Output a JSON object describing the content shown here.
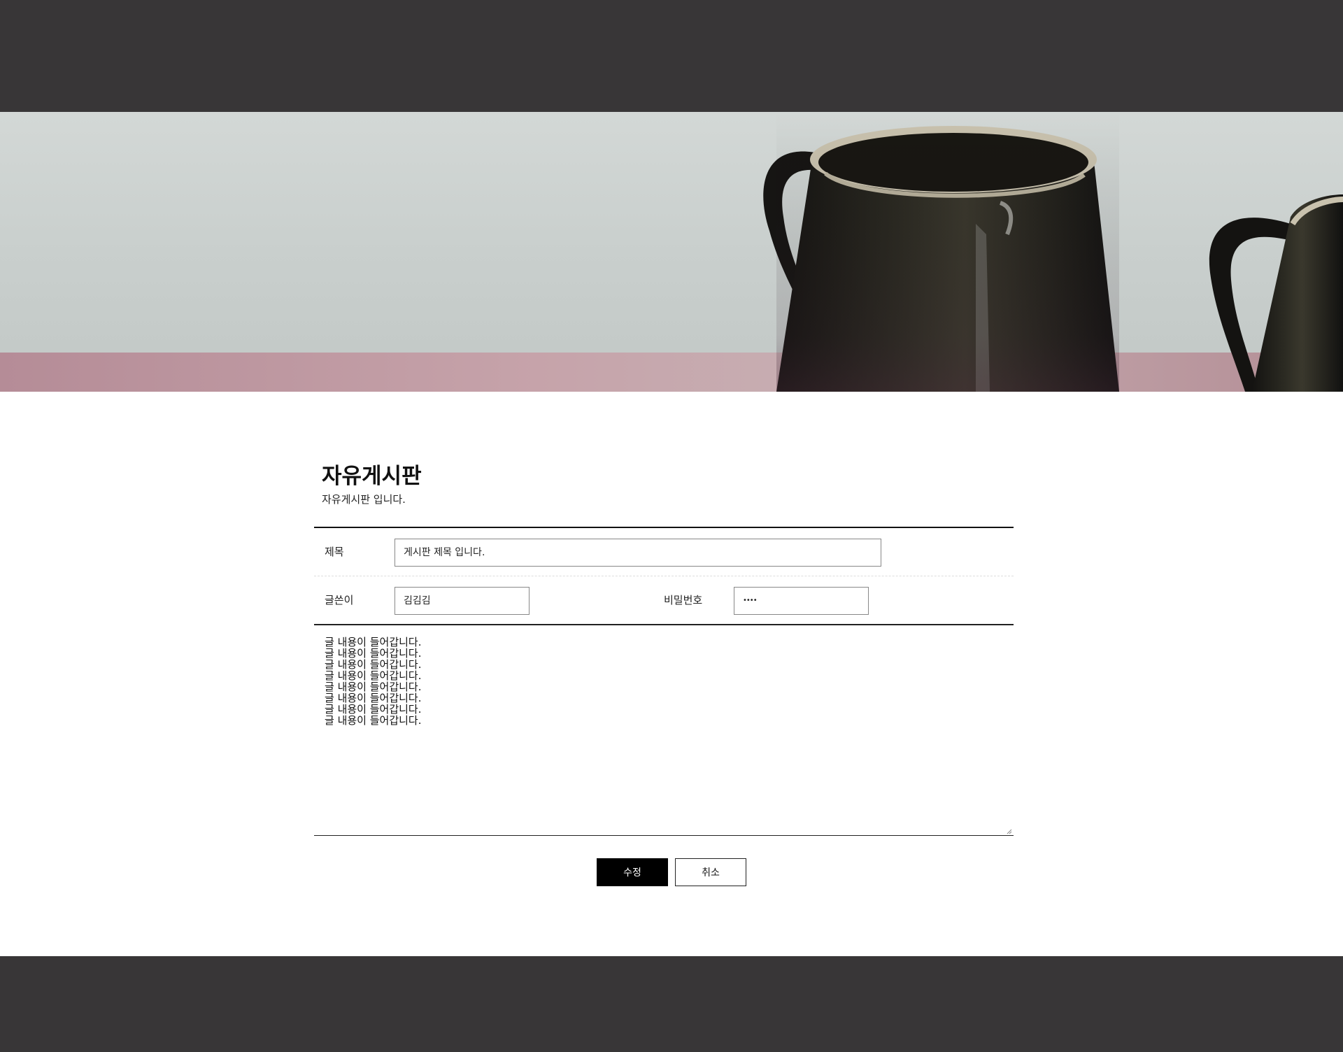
{
  "hero": {
    "image_name": "ceramic-mugs-banner"
  },
  "board": {
    "title": "자유게시판",
    "subtitle": "자유게시판 입니다."
  },
  "form": {
    "title_label": "제목",
    "title_value": "게시판 제목 입니다.",
    "author_label": "글쓴이",
    "author_value": "김김김",
    "password_label": "비밀번호",
    "password_value": "••••",
    "content": "글 내용이 들어갑니다.\n글 내용이 들어갑니다.\n글 내용이 들어갑니다.\n글 내용이 들어갑니다.\n글 내용이 들어갑니다.\n글 내용이 들어갑니다.\n글 내용이 들어갑니다.\n글 내용이 들어갑니다."
  },
  "buttons": {
    "submit_label": "수정",
    "cancel_label": "취소"
  },
  "colors": {
    "header_footer": "#383637",
    "primary_button": "#000000"
  }
}
